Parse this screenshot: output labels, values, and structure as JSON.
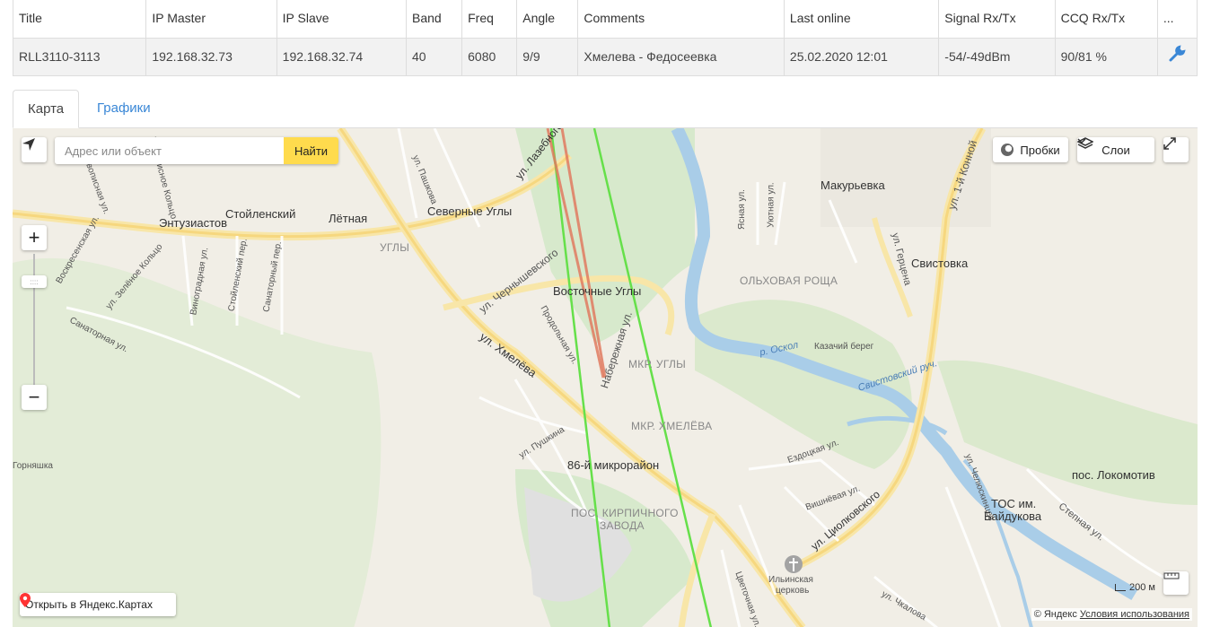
{
  "table": {
    "headers": [
      "Title",
      "IP Master",
      "IP Slave",
      "Band",
      "Freq",
      "Angle",
      "Comments",
      "Last online",
      "Signal Rx/Tx",
      "CCQ Rx/Tx",
      "..."
    ],
    "row": [
      "RLL3110-3113",
      "192.168.32.73",
      "192.168.32.74",
      "40",
      "6080",
      "9/9",
      "Хмелева - Федосеевка",
      "25.02.2020 12:01",
      "-54/-49dBm",
      "90/81 %"
    ],
    "action_icon": "wrench-icon"
  },
  "tabs": {
    "active": "Карта",
    "other": "Графики"
  },
  "map": {
    "search_placeholder": "Адрес или объект",
    "search_button": "Найти",
    "traffic_button": "Пробки",
    "layers_button": "Слои",
    "open_in_yandex": "Открыть в Яндекс.Картах",
    "scale": "200 м",
    "copyright_brand": "© Яндекс",
    "terms": "Условия использования",
    "labels": {
      "zhivolisnaya": "Живописная ул.",
      "zhivolisnoye": "Живописное Кольцо",
      "entuziastov": "Энтузиастов",
      "stoylenskiy": "Стойленский",
      "letnaya": "Лётная",
      "ugly": "УГЛЫ",
      "severnye": "Северные Углы",
      "pashkova": "ул. Пашкова",
      "lazebnogo": "ул. Лазебного",
      "vostochnye": "Восточные Углы",
      "chernyshevskogo": "ул. Чернышевского",
      "prodolnaya": "Продольная ул.",
      "naberezhnaya": "Набережная ул.",
      "khmeleva_st": "ул. Хмелёва",
      "mkr_ugly": "МКР. УГЛЫ",
      "mkr_khmeleva": "МКР. ХМЕЛЁВА",
      "pushkina": "ул. Пушкина",
      "mkr86": "86-й микрорайон",
      "pos_kirp": "ПОС. КИРПИЧНОГО",
      "zavoda": "ЗАВОДА",
      "olkhovaya": "ОЛЬХОВАЯ РОЩА",
      "makuryevka": "Макурьевка",
      "svistovka": "Свистовка",
      "gertsena": "ул. Герцена",
      "konnoy": "ул. 1-й Конной",
      "r_oskol": "р. Оскол",
      "kazachiy": "Казачий берег",
      "svistovskiy": "Свистовский руч.",
      "yasnaya": "Ясная ул.",
      "uyutnaya": "Уютная ул.",
      "ezdotskaya": "Ездоцкая ул.",
      "vishnevaya": "Вишнёвая ул.",
      "tsiolkovskogo": "ул. Циолковского",
      "ilinskaya": "Ильинская",
      "tserkov": "церковь",
      "chkalova": "ул. Чкалова",
      "tsvetochnaya": "Цветочная ул.",
      "chelyuskintsev": "ул. Челюскинцев",
      "tos": "ТОС им.",
      "baydukova": "Байдукова",
      "lokomotiv": "пос. Локомотив",
      "stepnaya": "Степная ул.",
      "gornyashka": "Горняшка",
      "sanatornaya": "Санаторная ул.",
      "voskresenskaya": "Воскресенская ул.",
      "zelenoe": "ул. Зелёное Кольцо",
      "vinogradnaya": "Виноградная ул.",
      "stoylenskiy_per": "Стойленский пер.",
      "sanatorny_per": "Санаторный пер."
    }
  },
  "colors": {
    "link": "#3a87d6",
    "search_button": "#ffdb4d",
    "link_line": "#66e04a",
    "beam": "#e07a5f",
    "river": "#a9cde8"
  }
}
